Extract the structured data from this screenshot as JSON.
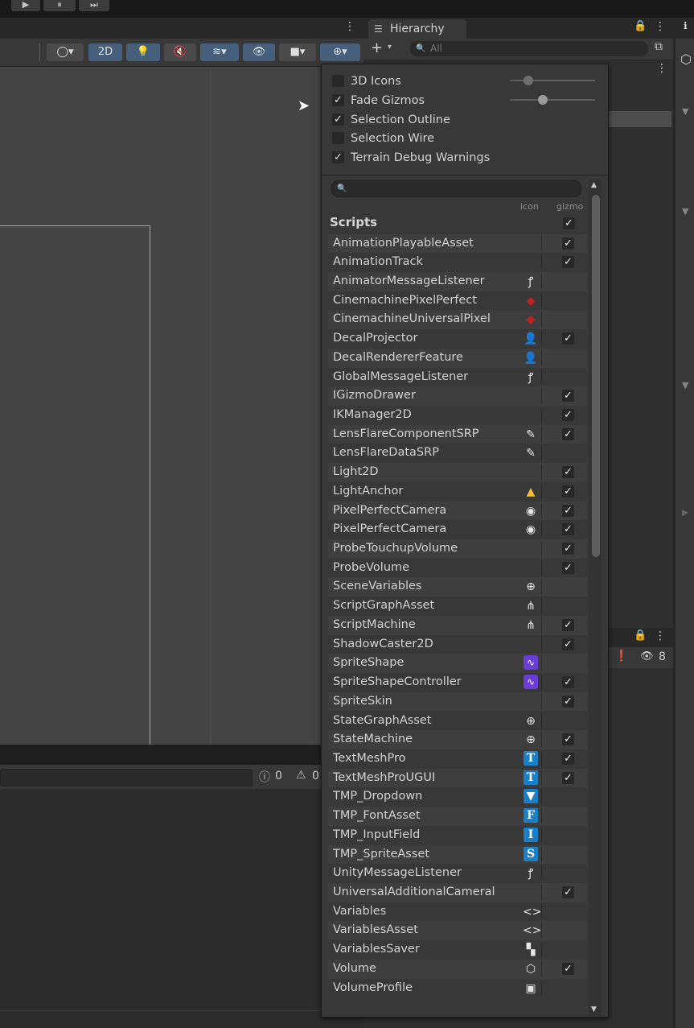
{
  "playbar": {
    "play_icon": "play-icon",
    "pause_icon": "pause-icon",
    "step_icon": "step-icon",
    "play": "▶",
    "pause": "⏸",
    "step": "⏭"
  },
  "scene_toolbar": {
    "mode_2d": "2D"
  },
  "console": {
    "error_count": "0",
    "warning_count": "0"
  },
  "hierarchy": {
    "title": "Hierarchy",
    "search_placeholder": "All",
    "add": "+"
  },
  "project": {
    "hidden_count": "8"
  },
  "gizmos_popup": {
    "options": [
      {
        "label": "3D Icons",
        "checked": false
      },
      {
        "label": "Fade Gizmos",
        "checked": true
      },
      {
        "label": "Selection Outline",
        "checked": true
      },
      {
        "label": "Selection Wire",
        "checked": false
      },
      {
        "label": "Terrain Debug Warnings",
        "checked": true
      }
    ],
    "col_icon": "icon",
    "col_gizmo": "gizmo",
    "section": "Scripts",
    "section_gizmo": true,
    "items": [
      {
        "name": "AnimationPlayableAsset",
        "icon": "",
        "gizmo": true
      },
      {
        "name": "AnimationTrack",
        "icon": "",
        "gizmo": true
      },
      {
        "name": "AnimatorMessageListener",
        "icon": "ear-icon",
        "gizmo": null
      },
      {
        "name": "CinemachinePixelPerfect",
        "icon": "cinemachine-icon",
        "gizmo": null
      },
      {
        "name": "CinemachineUniversalPixel",
        "icon": "cinemachine-icon",
        "gizmo": null
      },
      {
        "name": "DecalProjector",
        "icon": "decal-icon",
        "gizmo": true
      },
      {
        "name": "DecalRendererFeature",
        "icon": "decal-icon",
        "gizmo": null
      },
      {
        "name": "GlobalMessageListener",
        "icon": "ear-icon",
        "gizmo": null
      },
      {
        "name": "IGizmoDrawer",
        "icon": "",
        "gizmo": true
      },
      {
        "name": "IKManager2D",
        "icon": "",
        "gizmo": true
      },
      {
        "name": "LensFlareComponentSRP",
        "icon": "lensflare-icon",
        "gizmo": true
      },
      {
        "name": "LensFlareDataSRP",
        "icon": "lensflare-icon",
        "gizmo": null
      },
      {
        "name": "Light2D",
        "icon": "",
        "gizmo": true
      },
      {
        "name": "LightAnchor",
        "icon": "lightanchor-icon",
        "gizmo": true
      },
      {
        "name": "PixelPerfectCamera",
        "icon": "camera-icon",
        "gizmo": true
      },
      {
        "name": "PixelPerfectCamera",
        "icon": "camera-icon",
        "gizmo": true
      },
      {
        "name": "ProbeTouchupVolume",
        "icon": "",
        "gizmo": true
      },
      {
        "name": "ProbeVolume",
        "icon": "",
        "gizmo": true
      },
      {
        "name": "SceneVariables",
        "icon": "scene-variables-icon",
        "gizmo": null
      },
      {
        "name": "ScriptGraphAsset",
        "icon": "graph-icon",
        "gizmo": null
      },
      {
        "name": "ScriptMachine",
        "icon": "graph-icon",
        "gizmo": true
      },
      {
        "name": "ShadowCaster2D",
        "icon": "",
        "gizmo": true
      },
      {
        "name": "SpriteShape",
        "icon": "spriteshape-icon",
        "gizmo": null
      },
      {
        "name": "SpriteShapeController",
        "icon": "spriteshape-icon",
        "gizmo": true
      },
      {
        "name": "SpriteSkin",
        "icon": "",
        "gizmo": true
      },
      {
        "name": "StateGraphAsset",
        "icon": "state-icon",
        "gizmo": null
      },
      {
        "name": "StateMachine",
        "icon": "state-icon",
        "gizmo": true
      },
      {
        "name": "TextMeshPro",
        "icon": "tmp-text-icon",
        "gizmo": true
      },
      {
        "name": "TextMeshProUGUI",
        "icon": "tmp-text-icon",
        "gizmo": true
      },
      {
        "name": "TMP_Dropdown",
        "icon": "tmp-dropdown-icon",
        "gizmo": null
      },
      {
        "name": "TMP_FontAsset",
        "icon": "tmp-font-icon",
        "gizmo": null
      },
      {
        "name": "TMP_InputField",
        "icon": "tmp-input-icon",
        "gizmo": null
      },
      {
        "name": "TMP_SpriteAsset",
        "icon": "tmp-sprite-icon",
        "gizmo": null
      },
      {
        "name": "UnityMessageListener",
        "icon": "ear-icon",
        "gizmo": null
      },
      {
        "name": "UniversalAdditionalCameral",
        "icon": "",
        "gizmo": true
      },
      {
        "name": "Variables",
        "icon": "variables-icon",
        "gizmo": null
      },
      {
        "name": "VariablesAsset",
        "icon": "variables-icon",
        "gizmo": null
      },
      {
        "name": "VariablesSaver",
        "icon": "variables-saver-icon",
        "gizmo": null
      },
      {
        "name": "Volume",
        "icon": "volume-icon",
        "gizmo": true
      },
      {
        "name": "VolumeProfile",
        "icon": "volume-profile-icon",
        "gizmo": null
      }
    ]
  },
  "icon_glyphs": {
    "ear-icon": "ꝭ",
    "cinemachine-icon": "◆",
    "decal-icon": "👤",
    "lensflare-icon": "✎",
    "lightanchor-icon": "▲",
    "camera-icon": "◉",
    "scene-variables-icon": "⊕",
    "graph-icon": "⋔",
    "spriteshape-icon": "∿",
    "state-icon": "⊕",
    "tmp-text-icon": "T",
    "tmp-dropdown-icon": "▼",
    "tmp-font-icon": "F",
    "tmp-input-icon": "I",
    "tmp-sprite-icon": "S",
    "variables-icon": "<>",
    "variables-saver-icon": "▚",
    "volume-icon": "⬡",
    "volume-profile-icon": "▣"
  },
  "colors": {
    "accent_blue": "#1a7fc7",
    "accent_purple": "#6a3ed6",
    "cinemachine_red": "#c02020",
    "anchor_yellow": "#f0c030"
  }
}
